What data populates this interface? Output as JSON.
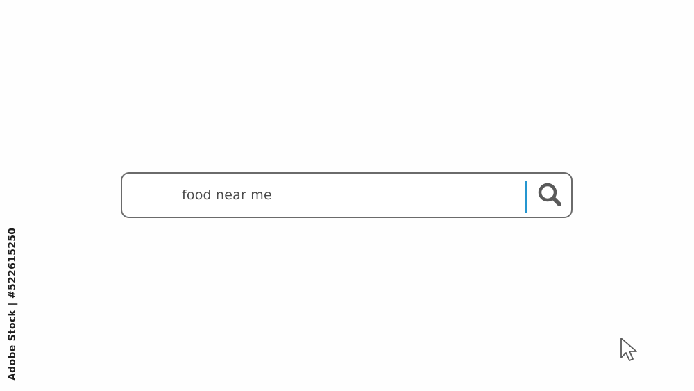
{
  "search": {
    "query": "food near me",
    "button_icon": "search-icon",
    "accent_color": "#2596d0",
    "border_color": "#6b6b6b"
  },
  "side_label": {
    "text": "Adobe Stock | #522615250"
  },
  "cursor": {
    "icon": "mouse-pointer-icon"
  }
}
